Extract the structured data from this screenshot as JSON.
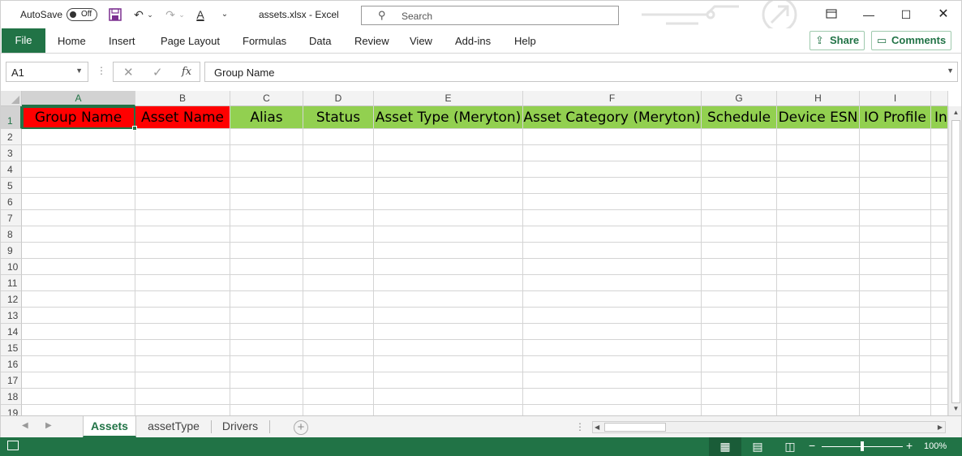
{
  "titlebar": {
    "autosave_label": "AutoSave",
    "autosave_state": "Off",
    "document_title": "assets.xlsx  -  Excel",
    "search_placeholder": "Search",
    "icons": [
      "save-icon",
      "undo-icon",
      "redo-icon",
      "font-color-icon",
      "customize-qat-icon",
      "ribbon-display-icon",
      "minimize-icon",
      "maximize-icon",
      "close-icon"
    ]
  },
  "menubar": {
    "file": "File",
    "items": [
      "Home",
      "Insert",
      "Page Layout",
      "Formulas",
      "Data",
      "Review",
      "View",
      "Add-ins",
      "Help"
    ],
    "share": "Share",
    "comments": "Comments"
  },
  "formulabar": {
    "name_box": "A1",
    "fx": "fx",
    "value": "Group Name"
  },
  "grid": {
    "columns": [
      "A",
      "B",
      "C",
      "D",
      "E",
      "F",
      "G",
      "H",
      "I"
    ],
    "rows": [
      "1",
      "2",
      "3",
      "4",
      "5",
      "6",
      "7",
      "8",
      "9",
      "10",
      "11",
      "12",
      "13",
      "14",
      "15",
      "16",
      "17",
      "18",
      "19"
    ],
    "header_cells": [
      {
        "text": "Group Name",
        "fill": "#ff0000"
      },
      {
        "text": "Asset Name",
        "fill": "#ff0000"
      },
      {
        "text": "Alias",
        "fill": "#92d050"
      },
      {
        "text": "Status",
        "fill": "#92d050"
      },
      {
        "text": "Asset Type (Meryton)",
        "fill": "#92d050"
      },
      {
        "text": "Asset Category (Meryton)",
        "fill": "#92d050"
      },
      {
        "text": "Schedule",
        "fill": "#92d050"
      },
      {
        "text": "Device ESN",
        "fill": "#92d050"
      },
      {
        "text": "IO Profile",
        "fill": "#92d050"
      },
      {
        "text": "In",
        "fill": "#92d050"
      }
    ],
    "active_cell": "A1"
  },
  "sheets": {
    "tabs": [
      "Assets",
      "assetType",
      "Drivers"
    ],
    "active": "Assets"
  },
  "statusbar": {
    "zoom": "100%"
  },
  "colors": {
    "excel_green": "#217346",
    "required_header": "#ff0000",
    "optional_header": "#92d050"
  }
}
